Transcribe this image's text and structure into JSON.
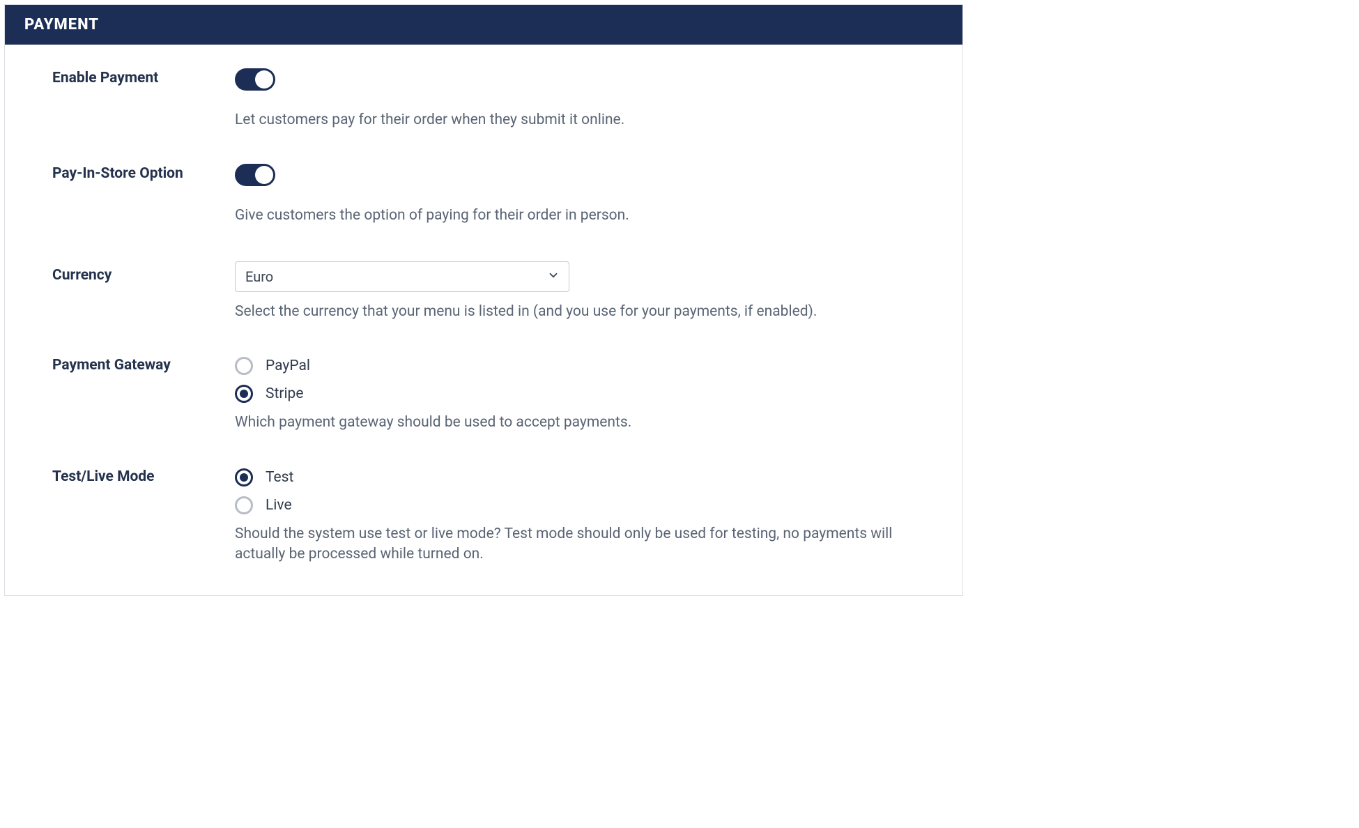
{
  "header": {
    "title": "PAYMENT"
  },
  "enable_payment": {
    "label": "Enable Payment",
    "on": true,
    "help": "Let customers pay for their order when they submit it online."
  },
  "pay_in_store": {
    "label": "Pay-In-Store Option",
    "on": true,
    "help": "Give customers the option of paying for their order in person."
  },
  "currency": {
    "label": "Currency",
    "selected": "Euro",
    "help": "Select the currency that your menu is listed in (and you use for your payments, if enabled)."
  },
  "gateway": {
    "label": "Payment Gateway",
    "options": [
      {
        "label": "PayPal",
        "checked": false
      },
      {
        "label": "Stripe",
        "checked": true
      }
    ],
    "help": "Which payment gateway should be used to accept payments."
  },
  "mode": {
    "label": "Test/Live Mode",
    "options": [
      {
        "label": "Test",
        "checked": true
      },
      {
        "label": "Live",
        "checked": false
      }
    ],
    "help": "Should the system use test or live mode? Test mode should only be used for testing, no payments will actually be processed while turned on."
  }
}
